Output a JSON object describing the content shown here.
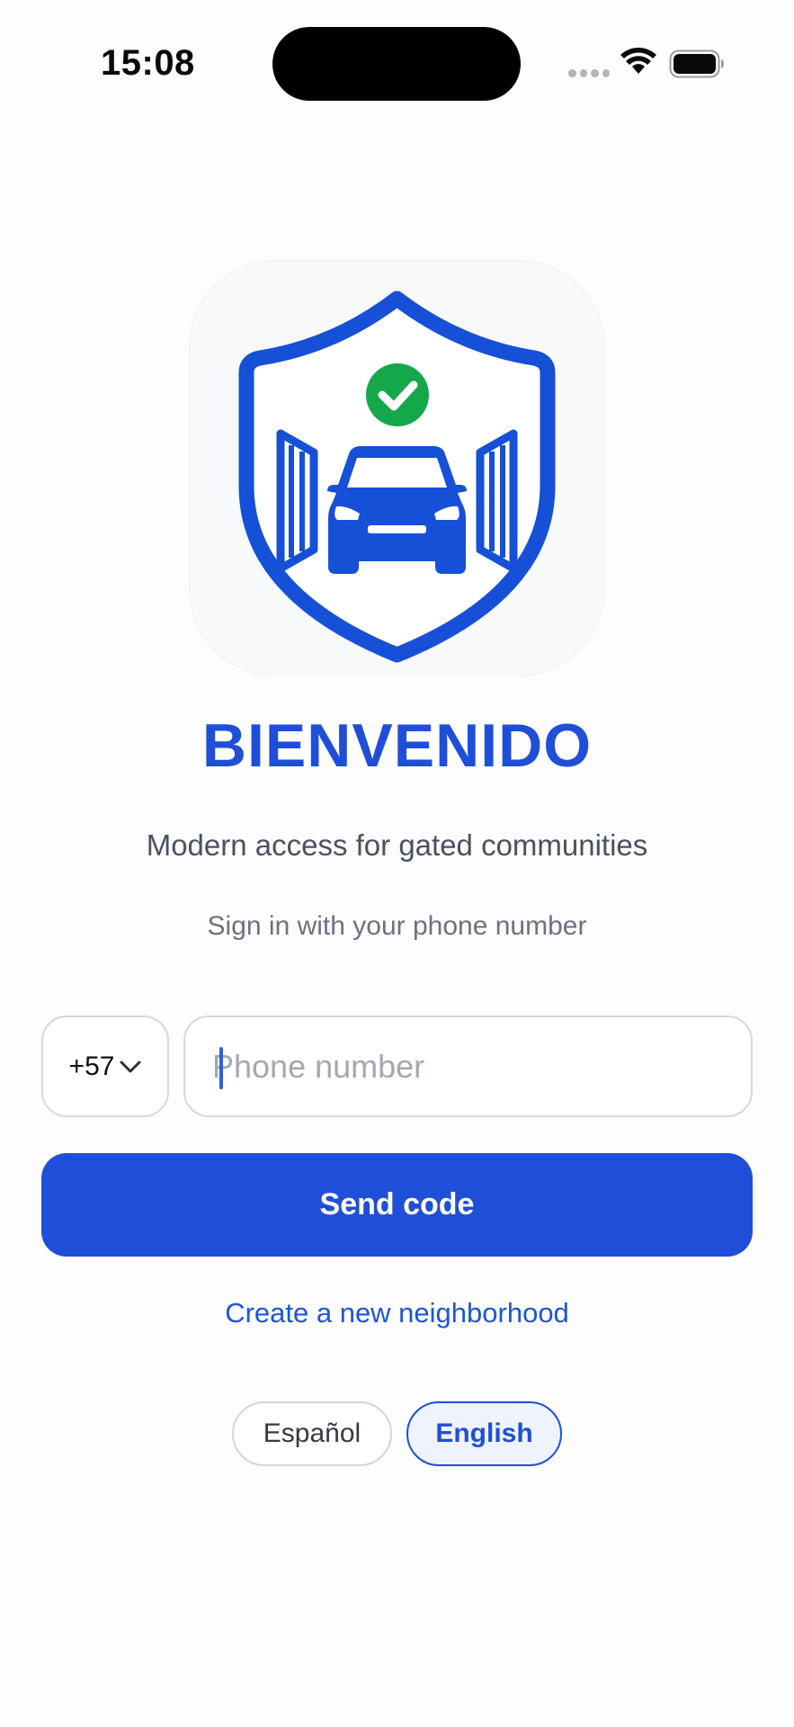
{
  "status_bar": {
    "time": "15:08",
    "icons": [
      "signal-dots-icon",
      "wifi-icon",
      "battery-icon"
    ]
  },
  "logo": {
    "icon": "shield-car-gate-logo",
    "colors": {
      "brand": "#1f4fd8",
      "check": "#14a84b",
      "background": "#f8f9fa"
    }
  },
  "welcome": {
    "title": "BIENVENIDO",
    "tagline": "Modern access for gated communities",
    "instruction": "Sign in with your phone number"
  },
  "phone_form": {
    "country_code": "+57",
    "phone_value": "",
    "phone_placeholder": "Phone number",
    "send_label": "Send code"
  },
  "create_neighborhood_label": "Create a new neighborhood",
  "languages": {
    "options": [
      "Español",
      "English"
    ],
    "selected": "English"
  },
  "colors": {
    "accent": "#1f4fd8",
    "text_secondary": "#4a5160",
    "text_muted": "#6b7280",
    "border": "#d6d8dd"
  }
}
